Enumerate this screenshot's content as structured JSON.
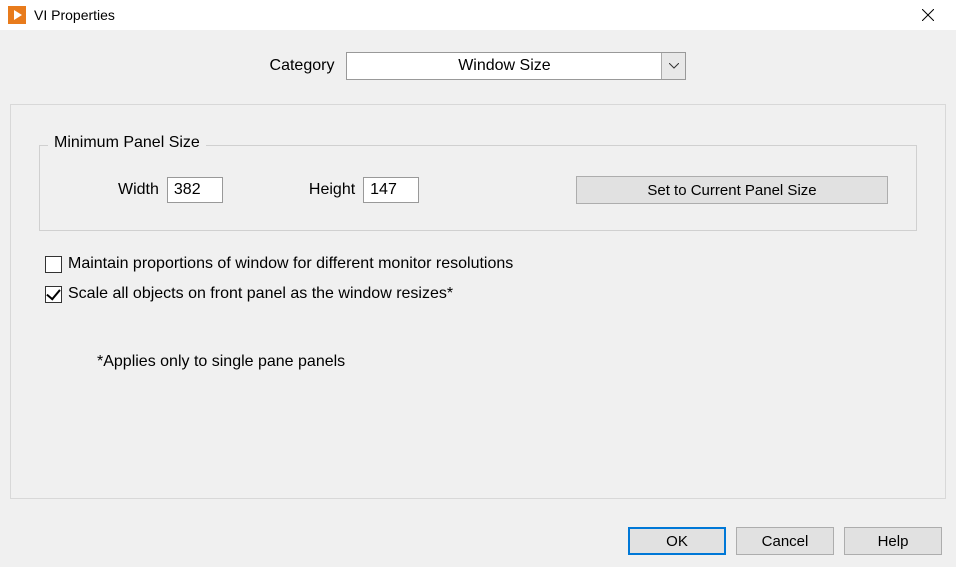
{
  "titlebar": {
    "title": "VI Properties"
  },
  "category": {
    "label": "Category",
    "value": "Window Size"
  },
  "groupbox": {
    "legend": "Minimum Panel Size",
    "width_label": "Width",
    "width_value": "382",
    "height_label": "Height",
    "height_value": "147",
    "set_current_label": "Set to Current Panel Size"
  },
  "checkboxes": {
    "maintain_label": "Maintain proportions of window for different monitor resolutions",
    "maintain_checked": false,
    "scale_label": "Scale all objects on front panel as the window resizes*",
    "scale_checked": true
  },
  "note": "*Applies only to single pane panels",
  "buttons": {
    "ok": "OK",
    "cancel": "Cancel",
    "help": "Help"
  }
}
